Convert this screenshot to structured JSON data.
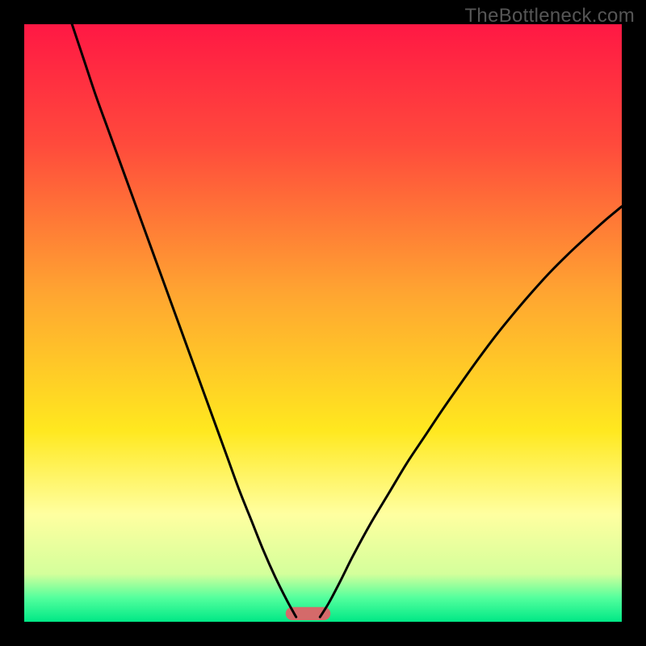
{
  "watermark": "TheBottleneck.com",
  "chart_data": {
    "type": "line",
    "title": "",
    "xlabel": "",
    "ylabel": "",
    "xlim": [
      0,
      100
    ],
    "ylim": [
      0,
      100
    ],
    "gradient_stops": [
      {
        "offset": 0,
        "color": "#ff1844"
      },
      {
        "offset": 20,
        "color": "#ff4a3c"
      },
      {
        "offset": 45,
        "color": "#ffa531"
      },
      {
        "offset": 68,
        "color": "#ffe81f"
      },
      {
        "offset": 82,
        "color": "#ffffa0"
      },
      {
        "offset": 92,
        "color": "#d4ff9b"
      },
      {
        "offset": 96,
        "color": "#53ff9d"
      },
      {
        "offset": 100,
        "color": "#00e886"
      }
    ],
    "marker": {
      "x": 47.5,
      "width": 7.5,
      "height": 2.2,
      "color": "#d46a6a",
      "radius": 1.1
    },
    "series": [
      {
        "name": "left-branch",
        "x": [
          8,
          10,
          12,
          14,
          16,
          18,
          20,
          22,
          24,
          26,
          28,
          30,
          32,
          34,
          36,
          38,
          40,
          42,
          44,
          45.5
        ],
        "y": [
          100,
          94,
          88,
          82.5,
          77,
          71.5,
          66,
          60.5,
          55,
          49.5,
          44,
          38.5,
          33,
          27.5,
          22,
          17,
          12,
          7.5,
          3.5,
          0.8
        ]
      },
      {
        "name": "right-branch",
        "x": [
          49.5,
          51,
          53,
          55,
          58,
          61,
          64,
          67,
          70,
          73,
          76,
          79,
          82,
          85,
          88,
          91,
          94,
          97,
          100
        ],
        "y": [
          0.8,
          3.2,
          7,
          11,
          16.5,
          21.5,
          26.5,
          31,
          35.5,
          39.8,
          44,
          48,
          51.7,
          55.2,
          58.5,
          61.5,
          64.3,
          67,
          69.5
        ]
      }
    ]
  }
}
